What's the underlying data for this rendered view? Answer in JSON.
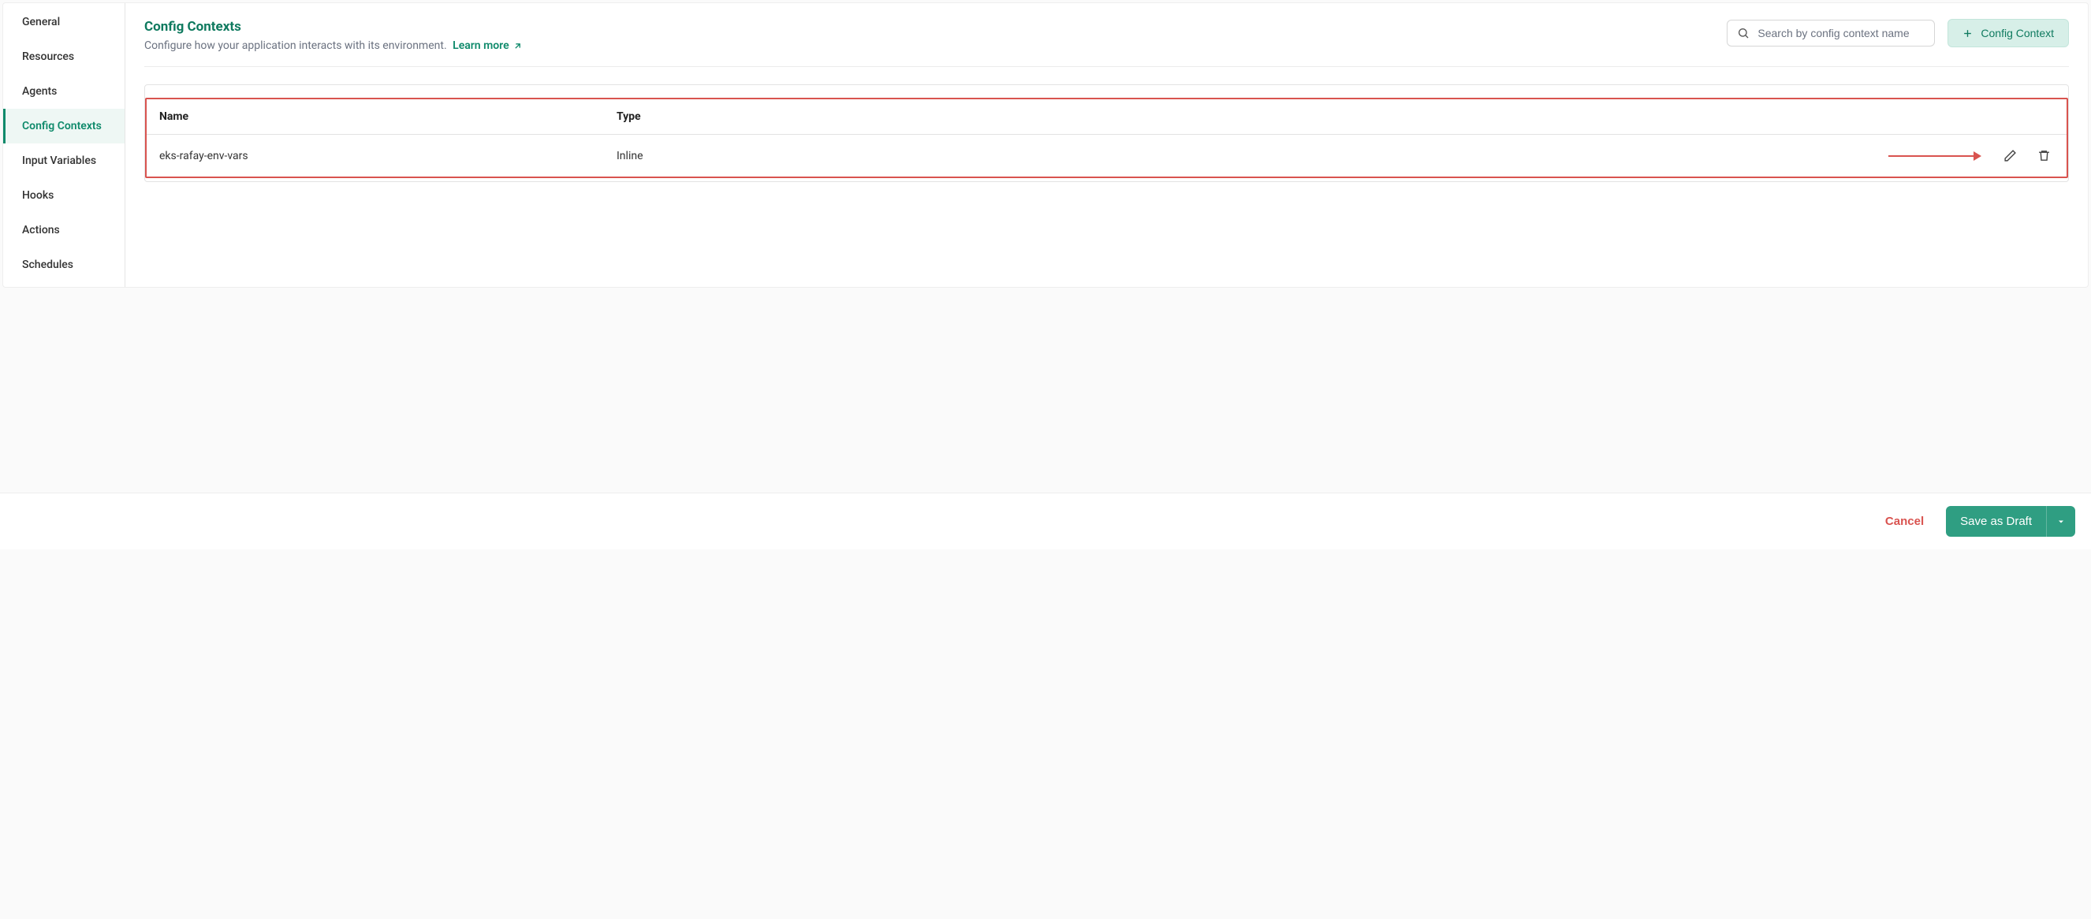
{
  "sidebar": {
    "items": [
      {
        "label": "General",
        "active": false
      },
      {
        "label": "Resources",
        "active": false
      },
      {
        "label": "Agents",
        "active": false
      },
      {
        "label": "Config Contexts",
        "active": true
      },
      {
        "label": "Input Variables",
        "active": false
      },
      {
        "label": "Hooks",
        "active": false
      },
      {
        "label": "Actions",
        "active": false
      },
      {
        "label": "Schedules",
        "active": false
      }
    ]
  },
  "header": {
    "title": "Config Contexts",
    "subtitle": "Configure how your application interacts with its environment.",
    "learn_more": "Learn more",
    "search_placeholder": "Search by config context name",
    "add_button": "Config Context"
  },
  "table": {
    "columns": {
      "name": "Name",
      "type": "Type"
    },
    "rows": [
      {
        "name": "eks-rafay-env-vars",
        "type": "Inline"
      }
    ]
  },
  "footer": {
    "cancel": "Cancel",
    "save": "Save as Draft"
  }
}
